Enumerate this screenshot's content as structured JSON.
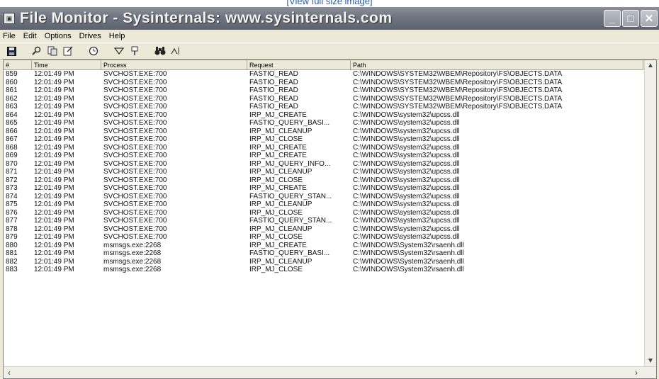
{
  "page_link": "[View full size image]",
  "window": {
    "title": "File Monitor - Sysinternals: www.sysinternals.com"
  },
  "menu": [
    "File",
    "Edit",
    "Options",
    "Drives",
    "Help"
  ],
  "toolbar_icons": [
    "save-icon",
    "find-icon",
    "copy-icon",
    "clear-icon",
    "clock-icon",
    "filter-icon",
    "highlight-icon",
    "binoculars-icon",
    "jump-icon"
  ],
  "columns": [
    "#",
    "Time",
    "Process",
    "Request",
    "Path"
  ],
  "rows": [
    [
      "859",
      "12:01:49 PM",
      "SVCHOST.EXE:700",
      "FASTIO_READ",
      "C:\\WINDOWS\\SYSTEM32\\WBEM\\Repository\\FS\\OBJECTS.DATA"
    ],
    [
      "860",
      "12:01:49 PM",
      "SVCHOST.EXE:700",
      "FASTIO_READ",
      "C:\\WINDOWS\\SYSTEM32\\WBEM\\Repository\\FS\\OBJECTS.DATA"
    ],
    [
      "861",
      "12:01:49 PM",
      "SVCHOST.EXE:700",
      "FASTIO_READ",
      "C:\\WINDOWS\\SYSTEM32\\WBEM\\Repository\\FS\\OBJECTS.DATA"
    ],
    [
      "862",
      "12:01:49 PM",
      "SVCHOST.EXE:700",
      "FASTIO_READ",
      "C:\\WINDOWS\\SYSTEM32\\WBEM\\Repository\\FS\\OBJECTS.DATA"
    ],
    [
      "863",
      "12:01:49 PM",
      "SVCHOST.EXE:700",
      "FASTIO_READ",
      "C:\\WINDOWS\\SYSTEM32\\WBEM\\Repository\\FS\\OBJECTS.DATA"
    ],
    [
      "864",
      "12:01:49 PM",
      "SVCHOST.EXE:700",
      "IRP_MJ_CREATE",
      "C:\\WINDOWS\\system32\\upcss.dll"
    ],
    [
      "865",
      "12:01:49 PM",
      "SVCHOST.EXE:700",
      "FASTIO_QUERY_BASI...",
      "C:\\WINDOWS\\system32\\upcss.dll"
    ],
    [
      "866",
      "12:01:49 PM",
      "SVCHOST.EXE:700",
      "IRP_MJ_CLEANUP",
      "C:\\WINDOWS\\system32\\upcss.dll"
    ],
    [
      "867",
      "12:01:49 PM",
      "SVCHOST.EXE:700",
      "IRP_MJ_CLOSE",
      "C:\\WINDOWS\\system32\\upcss.dll"
    ],
    [
      "868",
      "12:01:49 PM",
      "SVCHOST.EXE:700",
      "IRP_MJ_CREATE",
      "C:\\WINDOWS\\system32\\upcss.dll"
    ],
    [
      "869",
      "12:01:49 PM",
      "SVCHOST.EXE:700",
      "IRP_MJ_CREATE",
      "C:\\WINDOWS\\system32\\upcss.dll"
    ],
    [
      "870",
      "12:01:49 PM",
      "SVCHOST.EXE:700",
      "IRP_MJ_QUERY_INFO...",
      "C:\\WINDOWS\\system32\\upcss.dll"
    ],
    [
      "871",
      "12:01:49 PM",
      "SVCHOST.EXE:700",
      "IRP_MJ_CLEANUP",
      "C:\\WINDOWS\\system32\\upcss.dll"
    ],
    [
      "872",
      "12:01:49 PM",
      "SVCHOST.EXE:700",
      "IRP_MJ_CLOSE",
      "C:\\WINDOWS\\system32\\upcss.dll"
    ],
    [
      "873",
      "12:01:49 PM",
      "SVCHOST.EXE:700",
      "IRP_MJ_CREATE",
      "C:\\WINDOWS\\system32\\upcss.dll"
    ],
    [
      "874",
      "12:01:49 PM",
      "SVCHOST.EXE:700",
      "FASTIO_QUERY_STAN...",
      "C:\\WINDOWS\\system32\\upcss.dll"
    ],
    [
      "875",
      "12:01:49 PM",
      "SVCHOST.EXE:700",
      "IRP_MJ_CLEANUP",
      "C:\\WINDOWS\\system32\\upcss.dll"
    ],
    [
      "876",
      "12:01:49 PM",
      "SVCHOST.EXE:700",
      "IRP_MJ_CLOSE",
      "C:\\WINDOWS\\system32\\upcss.dll"
    ],
    [
      "877",
      "12:01:49 PM",
      "SVCHOST.EXE:700",
      "FASTIO_QUERY_STAN...",
      "C:\\WINDOWS\\system32\\upcss.dll"
    ],
    [
      "878",
      "12:01:49 PM",
      "SVCHOST.EXE:700",
      "IRP_MJ_CLEANUP",
      "C:\\WINDOWS\\system32\\upcss.dll"
    ],
    [
      "879",
      "12:01:49 PM",
      "SVCHOST.EXE:700",
      "IRP_MJ_CLOSE",
      "C:\\WINDOWS\\system32\\upcss.dll"
    ],
    [
      "880",
      "12:01:49 PM",
      "msmsgs.exe:2268",
      "IRP_MJ_CREATE",
      "C:\\WINDOWS\\System32\\rsaenh.dll"
    ],
    [
      "881",
      "12:01:49 PM",
      "msmsgs.exe:2268",
      "FASTIO_QUERY_BASI...",
      "C:\\WINDOWS\\System32\\rsaenh.dll"
    ],
    [
      "882",
      "12:01:49 PM",
      "msmsgs.exe:2268",
      "IRP_MJ_CLEANUP",
      "C:\\WINDOWS\\System32\\rsaenh.dll"
    ],
    [
      "883",
      "12:01:49 PM",
      "msmsgs.exe:2268",
      "IRP_MJ_CLOSE",
      "C:\\WINDOWS\\System32\\rsaenh.dll"
    ]
  ]
}
